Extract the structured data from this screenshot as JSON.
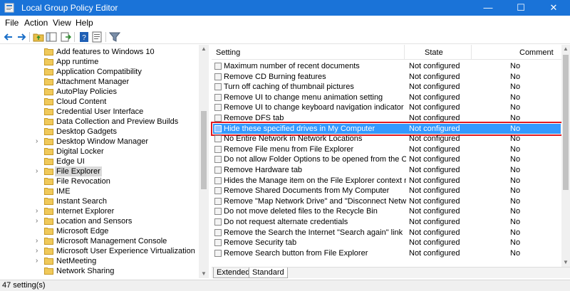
{
  "window": {
    "title": "Local Group Policy Editor",
    "minimize_glyph": "—",
    "maximize_glyph": "☐",
    "close_glyph": "✕"
  },
  "menu": [
    "File",
    "Action",
    "View",
    "Help"
  ],
  "toolbar_icons": [
    "back-arrow-icon",
    "forward-arrow-icon",
    "folder-up-icon",
    "show-hide-tree-icon",
    "export-list-icon",
    "help-icon",
    "properties-icon",
    "filter-icon"
  ],
  "tree": {
    "items": [
      {
        "label": "Add features to Windows 10",
        "expandable": false,
        "selected": false
      },
      {
        "label": "App runtime",
        "expandable": false,
        "selected": false
      },
      {
        "label": "Application Compatibility",
        "expandable": false,
        "selected": false
      },
      {
        "label": "Attachment Manager",
        "expandable": false,
        "selected": false
      },
      {
        "label": "AutoPlay Policies",
        "expandable": false,
        "selected": false
      },
      {
        "label": "Cloud Content",
        "expandable": false,
        "selected": false
      },
      {
        "label": "Credential User Interface",
        "expandable": false,
        "selected": false
      },
      {
        "label": "Data Collection and Preview Builds",
        "expandable": false,
        "selected": false
      },
      {
        "label": "Desktop Gadgets",
        "expandable": false,
        "selected": false
      },
      {
        "label": "Desktop Window Manager",
        "expandable": true,
        "selected": false
      },
      {
        "label": "Digital Locker",
        "expandable": false,
        "selected": false
      },
      {
        "label": "Edge UI",
        "expandable": false,
        "selected": false
      },
      {
        "label": "File Explorer",
        "expandable": true,
        "selected": true
      },
      {
        "label": "File Revocation",
        "expandable": false,
        "selected": false
      },
      {
        "label": "IME",
        "expandable": false,
        "selected": false
      },
      {
        "label": "Instant Search",
        "expandable": false,
        "selected": false
      },
      {
        "label": "Internet Explorer",
        "expandable": true,
        "selected": false
      },
      {
        "label": "Location and Sensors",
        "expandable": true,
        "selected": false
      },
      {
        "label": "Microsoft Edge",
        "expandable": false,
        "selected": false
      },
      {
        "label": "Microsoft Management Console",
        "expandable": true,
        "selected": false
      },
      {
        "label": "Microsoft User Experience Virtualization",
        "expandable": true,
        "selected": false
      },
      {
        "label": "NetMeeting",
        "expandable": true,
        "selected": false
      },
      {
        "label": "Network Sharing",
        "expandable": false,
        "selected": false
      }
    ]
  },
  "table": {
    "headers": {
      "setting": "Setting",
      "state": "State",
      "comment": "Comment"
    },
    "rows": [
      {
        "setting": "Maximum number of recent documents",
        "state": "Not configured",
        "comment": "No",
        "selected": false
      },
      {
        "setting": "Remove CD Burning features",
        "state": "Not configured",
        "comment": "No",
        "selected": false
      },
      {
        "setting": "Turn off caching of thumbnail pictures",
        "state": "Not configured",
        "comment": "No",
        "selected": false
      },
      {
        "setting": "Remove UI to change menu animation setting",
        "state": "Not configured",
        "comment": "No",
        "selected": false
      },
      {
        "setting": "Remove UI to change keyboard navigation indicator setting",
        "state": "Not configured",
        "comment": "No",
        "selected": false
      },
      {
        "setting": "Remove DFS tab",
        "state": "Not configured",
        "comment": "No",
        "selected": false
      },
      {
        "setting": "Hide these specified drives in My Computer",
        "state": "Not configured",
        "comment": "No",
        "selected": true
      },
      {
        "setting": "No Entire Network in Network Locations",
        "state": "Not configured",
        "comment": "No",
        "selected": false
      },
      {
        "setting": "Remove File menu from File Explorer",
        "state": "Not configured",
        "comment": "No",
        "selected": false
      },
      {
        "setting": "Do not allow Folder Options to be opened from the Options...",
        "state": "Not configured",
        "comment": "No",
        "selected": false
      },
      {
        "setting": "Remove Hardware tab",
        "state": "Not configured",
        "comment": "No",
        "selected": false
      },
      {
        "setting": "Hides the Manage item on the File Explorer context menu",
        "state": "Not configured",
        "comment": "No",
        "selected": false
      },
      {
        "setting": "Remove Shared Documents from My Computer",
        "state": "Not configured",
        "comment": "No",
        "selected": false
      },
      {
        "setting": "Remove \"Map Network Drive\" and \"Disconnect Network Dri...",
        "state": "Not configured",
        "comment": "No",
        "selected": false
      },
      {
        "setting": "Do not move deleted files to the Recycle Bin",
        "state": "Not configured",
        "comment": "No",
        "selected": false
      },
      {
        "setting": "Do not request alternate credentials",
        "state": "Not configured",
        "comment": "No",
        "selected": false
      },
      {
        "setting": "Remove the Search the Internet \"Search again\" link",
        "state": "Not configured",
        "comment": "No",
        "selected": false
      },
      {
        "setting": "Remove Security tab",
        "state": "Not configured",
        "comment": "No",
        "selected": false
      },
      {
        "setting": "Remove Search button from File Explorer",
        "state": "Not configured",
        "comment": "No",
        "selected": false
      }
    ]
  },
  "tabs": [
    "Extended",
    "Standard"
  ],
  "status": "47 setting(s)",
  "colors": {
    "titlebar": "#1a73d8",
    "selection": "#3399ff",
    "highlight_outline": "#e0191f"
  }
}
